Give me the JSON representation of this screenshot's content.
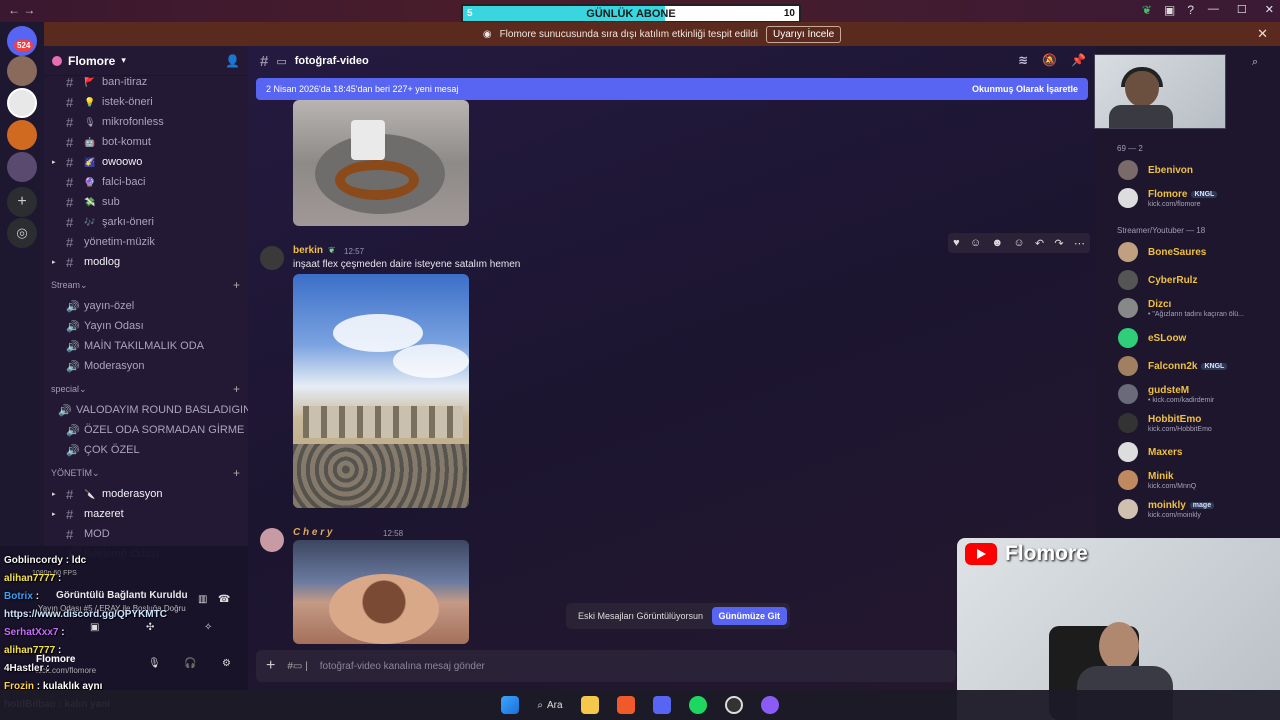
{
  "titlebar": {
    "goal_label": "GÜNLÜK ABONE",
    "goal_min": "5",
    "goal_max": "10",
    "goal_progress": 0.6
  },
  "notice": {
    "text": "Flomore sunucusunda sıra dışı katılım etkinliği tespit edildi",
    "button": "Uyarıyı İncele"
  },
  "rail": {
    "badge": "524"
  },
  "server": {
    "name": "Flomore"
  },
  "channels": [
    {
      "name": "ban-itiraz",
      "kind": "text",
      "emoji": "🚩",
      "bright": false
    },
    {
      "name": "istek-öneri",
      "kind": "text",
      "emoji": "💡",
      "bright": false
    },
    {
      "name": "mikrofonless",
      "kind": "text",
      "emoji": "🎙",
      "bright": false
    },
    {
      "name": "bot-komut",
      "kind": "text",
      "emoji": "🤖",
      "bright": false
    },
    {
      "name": "owoowo",
      "kind": "text",
      "emoji": "🌠",
      "bright": true
    },
    {
      "name": "falci-baci",
      "kind": "text",
      "emoji": "🔮",
      "bright": false
    },
    {
      "name": "sub",
      "kind": "text",
      "emoji": "💸",
      "bright": false
    },
    {
      "name": "şarkı-öneri",
      "kind": "text",
      "emoji": "🎶",
      "bright": false
    },
    {
      "name": "yönetim-müzik",
      "kind": "text",
      "emoji": "",
      "bright": false
    },
    {
      "name": "modlog",
      "kind": "text",
      "emoji": "",
      "bright": true
    }
  ],
  "categories": {
    "stream": "Stream",
    "special": "special",
    "yonetim": "YÖNETİM"
  },
  "stream_channels": [
    "yayın-özel",
    "Yayın Odası",
    "MAİN TAKILMALIK ODA",
    "Moderasyon"
  ],
  "special_channels": [
    "VALODAYIM ROUND BASLADIGIN...",
    "ÖZEL ODA SORMADAN GİRME",
    "ÇOK ÖZEL"
  ],
  "yonetim_channels": [
    {
      "name": "moderasyon",
      "kind": "text",
      "emoji": "🔪",
      "bright": true
    },
    {
      "name": "mazeret",
      "kind": "text",
      "emoji": "",
      "bright": true
    },
    {
      "name": "MOD",
      "kind": "text",
      "emoji": "",
      "bright": false
    },
    {
      "name": "Bekleme Odası",
      "kind": "voice",
      "emoji": "",
      "bright": false
    }
  ],
  "voice_panel": {
    "status": "Görüntülü Bağlantı Kuruldu",
    "location": "Yayın Odası #5 / ERAY ile Boşluğa Doğru",
    "quality": "1080p 60 FPS",
    "user_name": "Flomore",
    "user_status": "kick.com/flomore"
  },
  "chat_overlay": [
    {
      "user": "Goblincordy",
      "msg": ": ldc",
      "color": "#f5f5f5"
    },
    {
      "user": "alihan7777",
      "msg": ":",
      "color": "#f5e34a"
    },
    {
      "user": "Botrix",
      "msg": ":",
      "color": "#3aa0ff"
    },
    {
      "user": "",
      "msg": "https://www.discord.gg/QPYKMTC",
      "color": "#cfe3ff"
    },
    {
      "user": "SerhatXxx7",
      "msg": ":",
      "color": "#c86cff"
    },
    {
      "user": "alihan7777",
      "msg": ":",
      "color": "#f5e34a"
    },
    {
      "user": "4Hastler",
      "msg": ":",
      "color": "#f5f5f5"
    },
    {
      "user": "Frozin",
      "msg": ": kulaklık aynı",
      "color": "#ffd24a"
    },
    {
      "user": "holdBilbao",
      "msg": ": kalın yani",
      "color": "#f5f5f5"
    }
  ],
  "channel_header": {
    "name": "fotoğraf-video"
  },
  "new_messages": {
    "text": "2 Nisan 2026'da 18:45'dan beri 227+ yeni mesaj",
    "mark_read": "Okunmuş Olarak İşaretle"
  },
  "messages": [
    {
      "author": "berkin",
      "time": "12:57",
      "text": "inşaat flex çeşmeden daire isteyene satalım hemen",
      "color": "#f0c040"
    },
    {
      "author": "C h e r y",
      "time": "12:58",
      "text": "",
      "color": "#e0a860"
    }
  ],
  "toast": {
    "text": "Eski Mesajları Görüntülüyorsun",
    "button": "Günümüze Git"
  },
  "composer": {
    "placeholder": "fotoğraf-video kanalına mesaj gönder"
  },
  "members": {
    "group1": "69 — 2",
    "group2": "Streamer/Youtuber — 18",
    "list1": [
      {
        "name": "Ebenivon",
        "status": "",
        "tag": ""
      },
      {
        "name": "Flomore",
        "status": "kick.com/flomore",
        "tag": "KNGL"
      }
    ],
    "list2": [
      {
        "name": "BoneSaures",
        "status": "",
        "tag": ""
      },
      {
        "name": "CyberRulz",
        "status": "",
        "tag": ""
      },
      {
        "name": "Dizcı",
        "status": "• \"Ağızların tadını kaçıran ölü...",
        "tag": ""
      },
      {
        "name": "eSLoow",
        "status": "",
        "tag": ""
      },
      {
        "name": "Falconn2k",
        "status": "",
        "tag": "KNGL"
      },
      {
        "name": "gudsteM",
        "status": "• kick.com/kadirdemir",
        "tag": ""
      },
      {
        "name": "HobbitEmo",
        "status": "kick.com/HobbitEmo",
        "tag": ""
      },
      {
        "name": "Maxers",
        "status": "",
        "tag": ""
      },
      {
        "name": "Minik",
        "status": "kick.com/MnnQ",
        "tag": ""
      },
      {
        "name": "moinkly",
        "status": "kick.com/moinkly",
        "tag": "mage"
      }
    ]
  },
  "webcam": {
    "banner": "Flomore"
  },
  "taskbar": {
    "search": "Ara"
  },
  "colors": {
    "accent": "#5865f2",
    "notice_bg": "#5b2a1e",
    "member_name": "#f0c040"
  }
}
